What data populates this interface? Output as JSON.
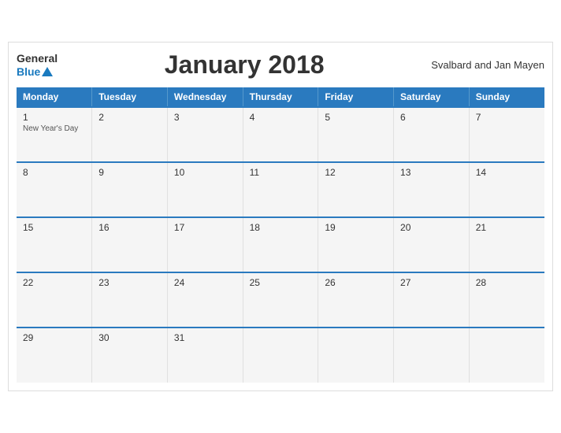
{
  "header": {
    "logo_general": "General",
    "logo_blue": "Blue",
    "title": "January 2018",
    "region": "Svalbard and Jan Mayen"
  },
  "days_of_week": [
    "Monday",
    "Tuesday",
    "Wednesday",
    "Thursday",
    "Friday",
    "Saturday",
    "Sunday"
  ],
  "weeks": [
    [
      {
        "day": "1",
        "event": "New Year's Day"
      },
      {
        "day": "2",
        "event": ""
      },
      {
        "day": "3",
        "event": ""
      },
      {
        "day": "4",
        "event": ""
      },
      {
        "day": "5",
        "event": ""
      },
      {
        "day": "6",
        "event": ""
      },
      {
        "day": "7",
        "event": ""
      }
    ],
    [
      {
        "day": "8",
        "event": ""
      },
      {
        "day": "9",
        "event": ""
      },
      {
        "day": "10",
        "event": ""
      },
      {
        "day": "11",
        "event": ""
      },
      {
        "day": "12",
        "event": ""
      },
      {
        "day": "13",
        "event": ""
      },
      {
        "day": "14",
        "event": ""
      }
    ],
    [
      {
        "day": "15",
        "event": ""
      },
      {
        "day": "16",
        "event": ""
      },
      {
        "day": "17",
        "event": ""
      },
      {
        "day": "18",
        "event": ""
      },
      {
        "day": "19",
        "event": ""
      },
      {
        "day": "20",
        "event": ""
      },
      {
        "day": "21",
        "event": ""
      }
    ],
    [
      {
        "day": "22",
        "event": ""
      },
      {
        "day": "23",
        "event": ""
      },
      {
        "day": "24",
        "event": ""
      },
      {
        "day": "25",
        "event": ""
      },
      {
        "day": "26",
        "event": ""
      },
      {
        "day": "27",
        "event": ""
      },
      {
        "day": "28",
        "event": ""
      }
    ],
    [
      {
        "day": "29",
        "event": ""
      },
      {
        "day": "30",
        "event": ""
      },
      {
        "day": "31",
        "event": ""
      },
      {
        "day": "",
        "event": ""
      },
      {
        "day": "",
        "event": ""
      },
      {
        "day": "",
        "event": ""
      },
      {
        "day": "",
        "event": ""
      }
    ]
  ],
  "colors": {
    "header_bg": "#2a7abf",
    "header_text": "#ffffff",
    "cell_bg": "#f5f5f5",
    "border_top": "#2a7abf"
  }
}
